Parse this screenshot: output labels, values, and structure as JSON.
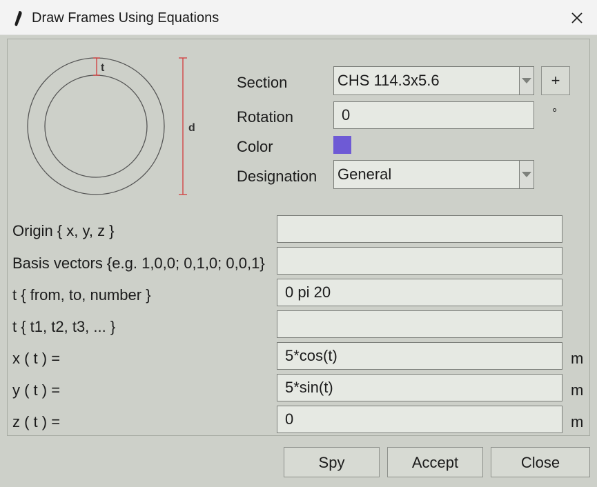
{
  "window": {
    "title": "Draw Frames Using Equations"
  },
  "icons": {
    "app": "pen-icon",
    "close": "close-icon"
  },
  "preview": {
    "thickness_label": "t",
    "diameter_label": "d"
  },
  "section": {
    "section_label": "Section",
    "section_value": "CHS 114.3x5.6",
    "add_label": "+",
    "rotation_label": "Rotation",
    "rotation_value": "0",
    "rotation_unit": "°",
    "color_label": "Color",
    "color_value": "#6e5ad5",
    "designation_label": "Designation",
    "designation_value": "General"
  },
  "params": {
    "origin_label": "Origin { x, y, z }",
    "origin_value": "",
    "basis_label": "Basis vectors {e.g. 1,0,0; 0,1,0; 0,0,1}",
    "basis_value": "",
    "trange_label": "t { from, to, number }",
    "trange_value": "0 pi 20",
    "tlist_label": "t { t1, t2, t3, ... }",
    "tlist_value": "",
    "x_label": "x ( t ) =",
    "x_value": "5*cos(t)",
    "y_label": "y ( t ) =",
    "y_value": "5*sin(t)",
    "z_label": "z ( t ) =",
    "z_value": "0",
    "unit": "m"
  },
  "buttons": {
    "spy": "Spy",
    "accept": "Accept",
    "close": "Close"
  }
}
